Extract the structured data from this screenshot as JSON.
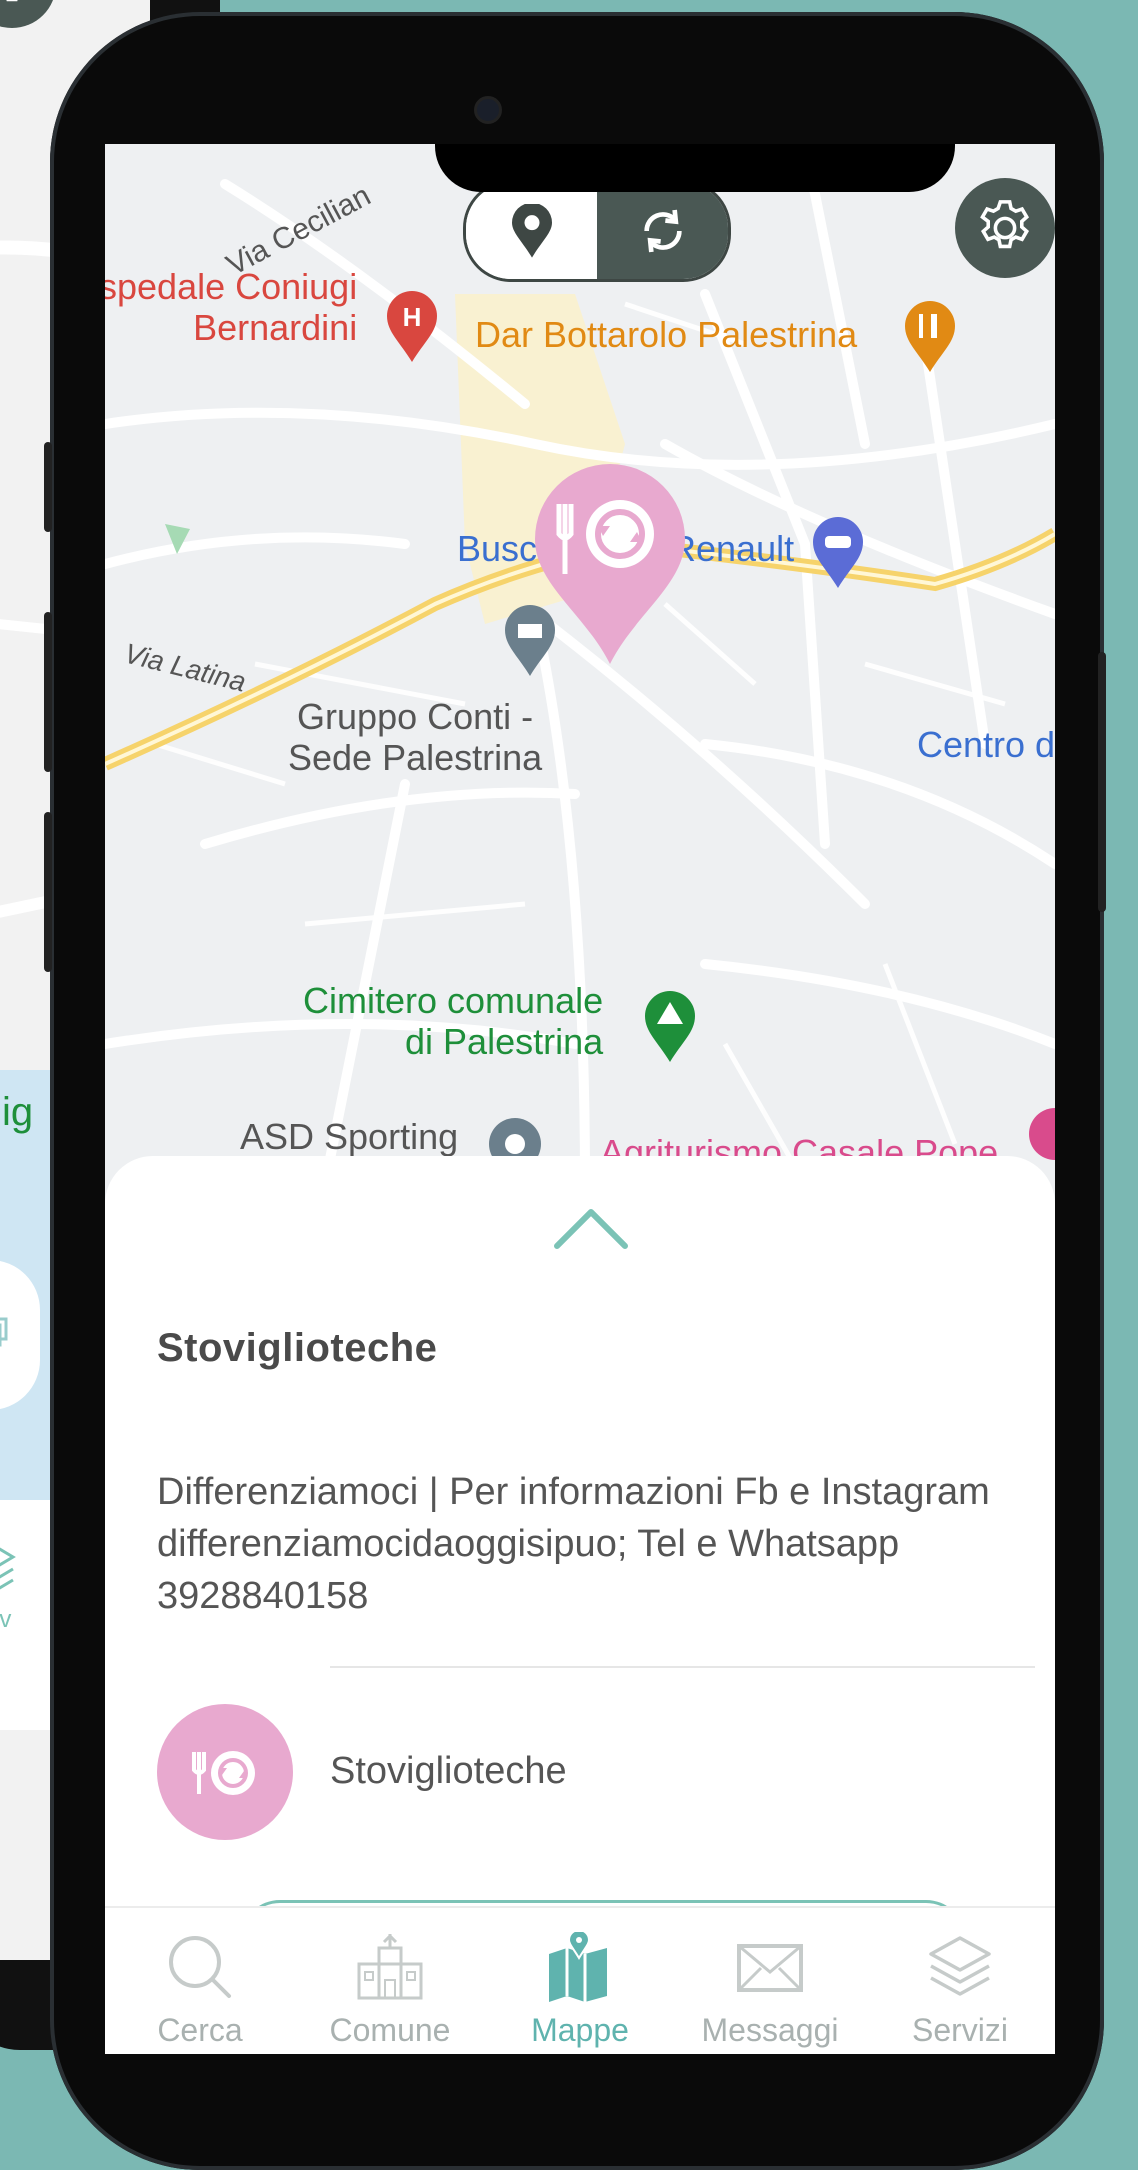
{
  "background_phone": {
    "partial_tab_label": "Serv",
    "partial_text": "ig"
  },
  "map": {
    "labels": {
      "via_ceciliana": "Via Cecilian",
      "hospital": "spedale Coniugi\nBernardini",
      "restaurant": "Dar Bottarolo Palestrina",
      "busc": "Busc",
      "renault": "Renault",
      "via_latina": "Via Latina",
      "gruppo_conti": "Gruppo Conti -\nSede Palestrina",
      "centro": "Centro d",
      "cimitero": "Cimitero comunale\ndi Palestrina",
      "asd_sporting": "ASD Sporting",
      "agriturismo": "Agriturismo Casale Pope"
    },
    "colors": {
      "hospital_red": "#d9473f",
      "restaurant_orange": "#e18a14",
      "poi_blue": "#3a6fd0",
      "park_green": "#1e8f3a",
      "road_yellow": "#f6d36b",
      "pin_pink": "#e8a9cf"
    }
  },
  "map_toggle": {
    "left_icon": "map-pin-icon",
    "right_icon": "refresh-cycle-icon"
  },
  "settings": {
    "icon": "gear-icon"
  },
  "sheet": {
    "title": "Stoviglioteche",
    "description": "Differenziamoci | Per informazioni Fb e Instagram differenziamocidaoggisipuo; Tel e Whatsapp 3928840158",
    "category_label": "Stoviglioteche",
    "category_icon": "cutlery-recycle-icon"
  },
  "tabbar": {
    "items": [
      {
        "label": "Cerca",
        "icon": "search-icon"
      },
      {
        "label": "Comune",
        "icon": "town-hall-icon"
      },
      {
        "label": "Mappe",
        "icon": "map-icon",
        "active": true
      },
      {
        "label": "Messaggi",
        "icon": "envelope-icon"
      },
      {
        "label": "Servizi",
        "icon": "layers-icon"
      }
    ],
    "active_color": "#5fb3ae",
    "inactive_color": "#a9b1b0"
  }
}
